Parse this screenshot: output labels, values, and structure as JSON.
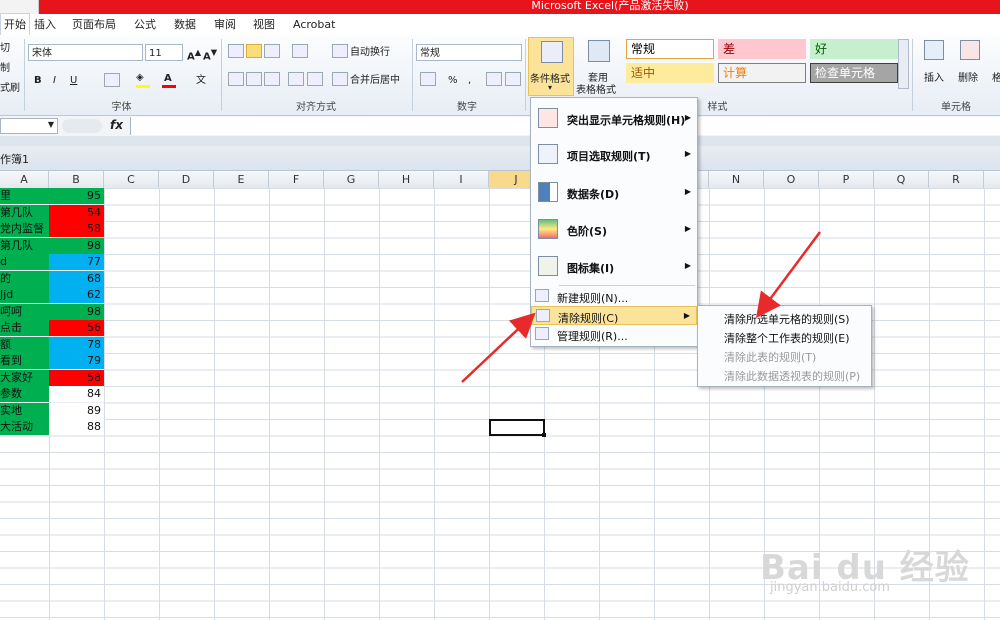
{
  "window": {
    "title": "Microsoft Excel(产品激活失败)"
  },
  "tabs": [
    "开始",
    "插入",
    "页面布局",
    "公式",
    "数据",
    "审阅",
    "视图",
    "Acrobat"
  ],
  "clipboard": {
    "cut": "切",
    "copy": "制",
    "format_painter": "式刷"
  },
  "font": {
    "name": "宋体",
    "size": "11",
    "group_label": "字体"
  },
  "alignment": {
    "wrap": "自动换行",
    "merge": "合并后居中",
    "group_label": "对齐方式"
  },
  "number": {
    "format": "常规",
    "group_label": "数字"
  },
  "styles": {
    "conditional_format": "条件格式",
    "table_format_1": "套用",
    "table_format_2": "表格格式",
    "cells": [
      {
        "label": "常规",
        "bg": "#ffffff",
        "fg": "#000000",
        "border": "#e6a33a"
      },
      {
        "label": "差",
        "bg": "#ffc7ce",
        "fg": "#9c0006",
        "border": "#ffc7ce"
      },
      {
        "label": "好",
        "bg": "#c6efce",
        "fg": "#006100",
        "border": "#c6efce"
      },
      {
        "label": "适中",
        "bg": "#ffeb9c",
        "fg": "#9c5700",
        "border": "#ffeb9c"
      },
      {
        "label": "计算",
        "bg": "#f2f2f2",
        "fg": "#fa7d00",
        "border": "#7f7f7f"
      },
      {
        "label": "检查单元格",
        "bg": "#a5a5a5",
        "fg": "#ffffff",
        "border": "#3f3f3f"
      }
    ],
    "group_label": "样式"
  },
  "cells_group": {
    "insert": "插入",
    "delete": "删除",
    "format": "格",
    "group_label": "单元格"
  },
  "formula_bar": {
    "fx": "fx",
    "value": ""
  },
  "workbook": {
    "title": "作簿1"
  },
  "columns": [
    "A",
    "B",
    "C",
    "D",
    "E",
    "F",
    "G",
    "H",
    "I",
    "J",
    "K",
    "L",
    "M",
    "N",
    "O",
    "P",
    "Q",
    "R"
  ],
  "rows": [
    {
      "a": "里",
      "b": "95",
      "color": "#00b050"
    },
    {
      "a": "第几队",
      "b": "54",
      "color": "#ff0000"
    },
    {
      "a": "党内监督",
      "b": "58",
      "color": "#ff0000"
    },
    {
      "a": "第几队",
      "b": "98",
      "color": "#00b050"
    },
    {
      "a": "d",
      "b": "77",
      "color": "#00b0f0"
    },
    {
      "a": "的",
      "b": "68",
      "color": "#00b0f0"
    },
    {
      "a": "Jjd",
      "b": "62",
      "color": "#00b0f0"
    },
    {
      "a": "呵呵",
      "b": "98",
      "color": "#00b050"
    },
    {
      "a": "点击",
      "b": "56",
      "color": "#ff0000"
    },
    {
      "a": "额",
      "b": "78",
      "color": "#00b0f0"
    },
    {
      "a": "看到",
      "b": "79",
      "color": "#00b0f0"
    },
    {
      "a": "大家好",
      "b": "58",
      "color": "#ff0000"
    },
    {
      "a": "参数",
      "b": "84",
      "color": "#ffffff"
    },
    {
      "a": "实地",
      "b": "89",
      "color": "#ffffff"
    },
    {
      "a": "大活动",
      "b": "88",
      "color": "#ffffff"
    }
  ],
  "a_column_color": "#00b050",
  "cf_menu": {
    "highlight": "突出显示单元格规则(H)",
    "topbottom": "项目选取规则(T)",
    "databars": "数据条(D)",
    "colorscales": "色阶(S)",
    "iconsets": "图标集(I)",
    "new_rule": "新建规则(N)...",
    "clear_rules": "清除规则(C)",
    "manage_rules": "管理规则(R)..."
  },
  "clear_submenu": {
    "selected": "清除所选单元格的规则(S)",
    "sheet": "清除整个工作表的规则(E)",
    "table": "清除此表的规则(T)",
    "pivot": "清除此数据透视表的规则(P)"
  },
  "watermark": {
    "brand": "Bai du 经验",
    "url": "jingyan.baidu.com"
  }
}
